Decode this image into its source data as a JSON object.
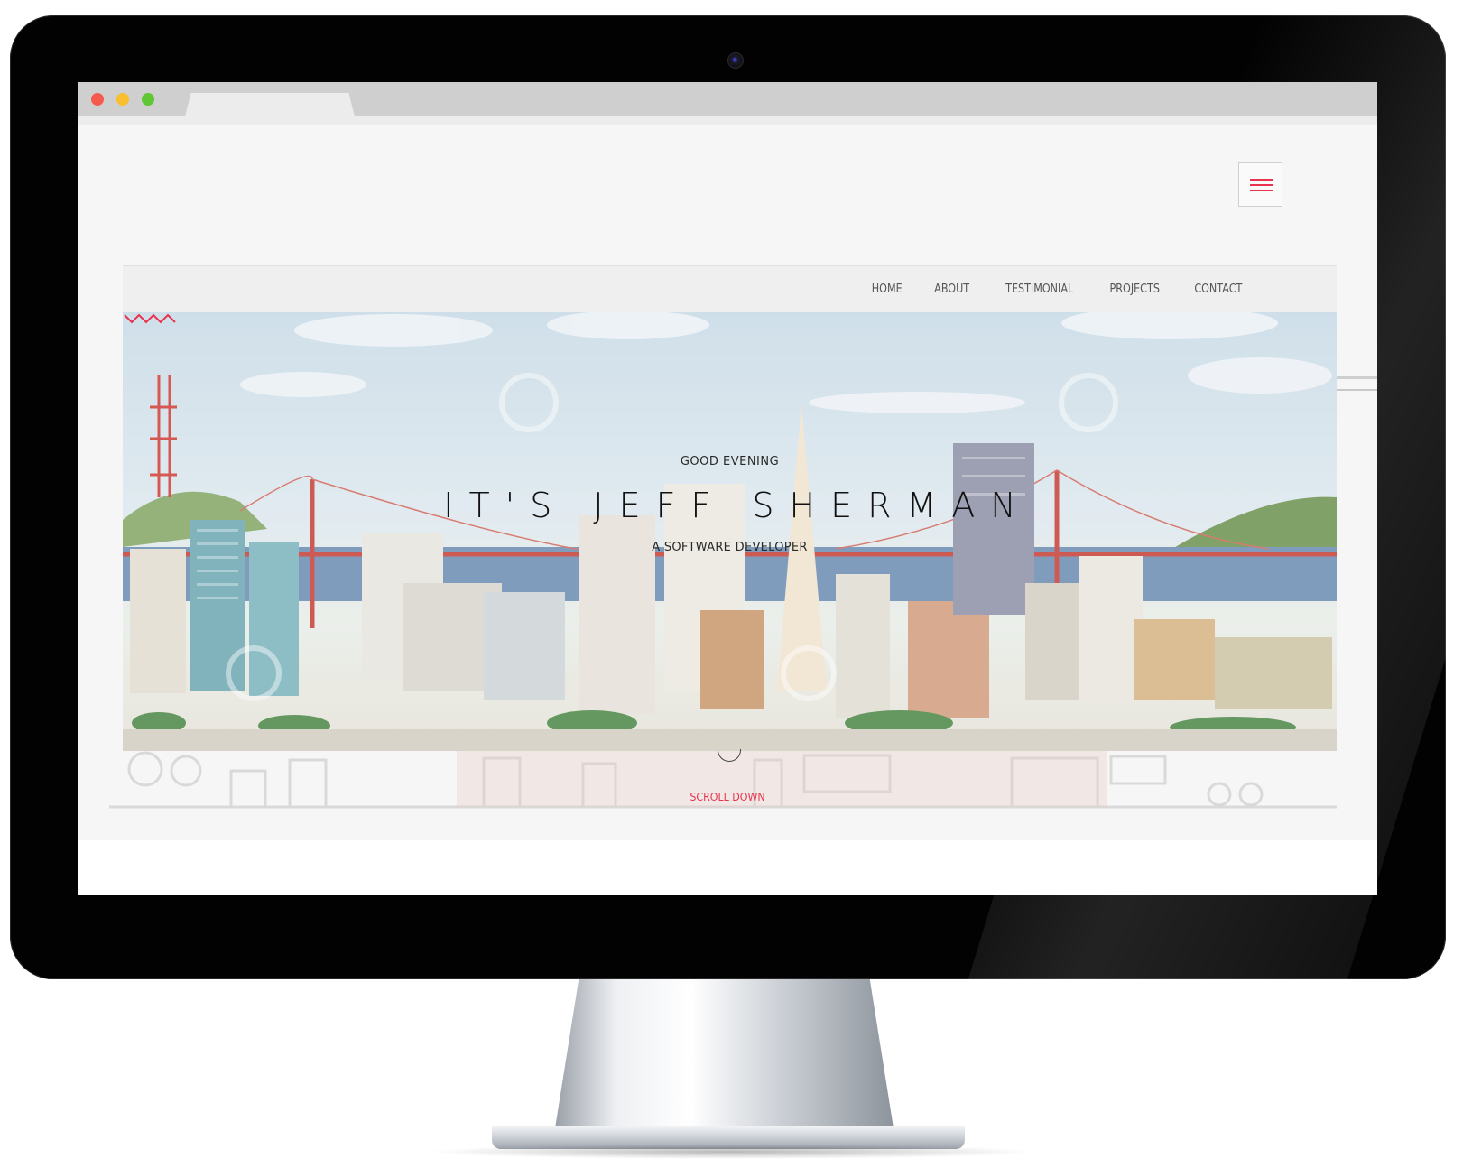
{
  "nav": {
    "items": [
      {
        "label": "HOME"
      },
      {
        "label": "ABOUT"
      },
      {
        "label": "TESTIMONIAL"
      },
      {
        "label": "PROJECTS"
      },
      {
        "label": "CONTACT"
      }
    ],
    "menu_icon": "hamburger-menu-icon"
  },
  "hero": {
    "greeting": "GOOD EVENING",
    "name": "IT'S JEFF SHERMAN",
    "role": "A SOFTWARE DEVELOPER",
    "divider_icon": "zigzag-icon"
  },
  "scroll": {
    "label": "SCROLL DOWN",
    "icon": "scroll-mouse-icon"
  },
  "browser": {
    "controls": [
      "close",
      "minimize",
      "maximize"
    ]
  },
  "colors": {
    "accent": "#e8344e",
    "close": "#f45a4e",
    "minimize": "#f9bf2e",
    "maximize": "#5ec733",
    "page_background": "#f6f6f6",
    "navbar_background": "#efefef"
  }
}
